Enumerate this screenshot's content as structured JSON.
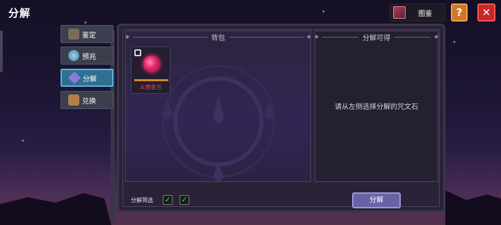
{
  "header": {
    "title": "分解",
    "codex_label": "图鉴",
    "help_label": "?",
    "close_label": "✕"
  },
  "tabs": [
    {
      "label": "鉴定",
      "icon": "helmet-icon",
      "active": false
    },
    {
      "label": "预兆",
      "icon": "crystal-ball-icon",
      "active": false
    },
    {
      "label": "分解",
      "icon": "diamond-rune-icon",
      "active": true
    },
    {
      "label": "兑换",
      "icon": "treasure-chest-icon",
      "active": false
    }
  ],
  "backpack": {
    "title": "背包",
    "items": [
      {
        "name": "义络金兰",
        "icon": "red-gem-icon",
        "locked": true
      }
    ]
  },
  "result": {
    "title": "分解可得",
    "hint": "请从左侧选择分解的咒文石"
  },
  "footer": {
    "filter_label": "分解筛选",
    "checkboxes": [
      true,
      true
    ],
    "check_mark": "✓",
    "decompose_label": "分解"
  },
  "colors": {
    "active_tab": "#2f6f92",
    "decompose_button": "#6a62a6",
    "item_name": "#ff4a4a",
    "close_button": "#c8262a",
    "help_button": "#d0762a"
  }
}
